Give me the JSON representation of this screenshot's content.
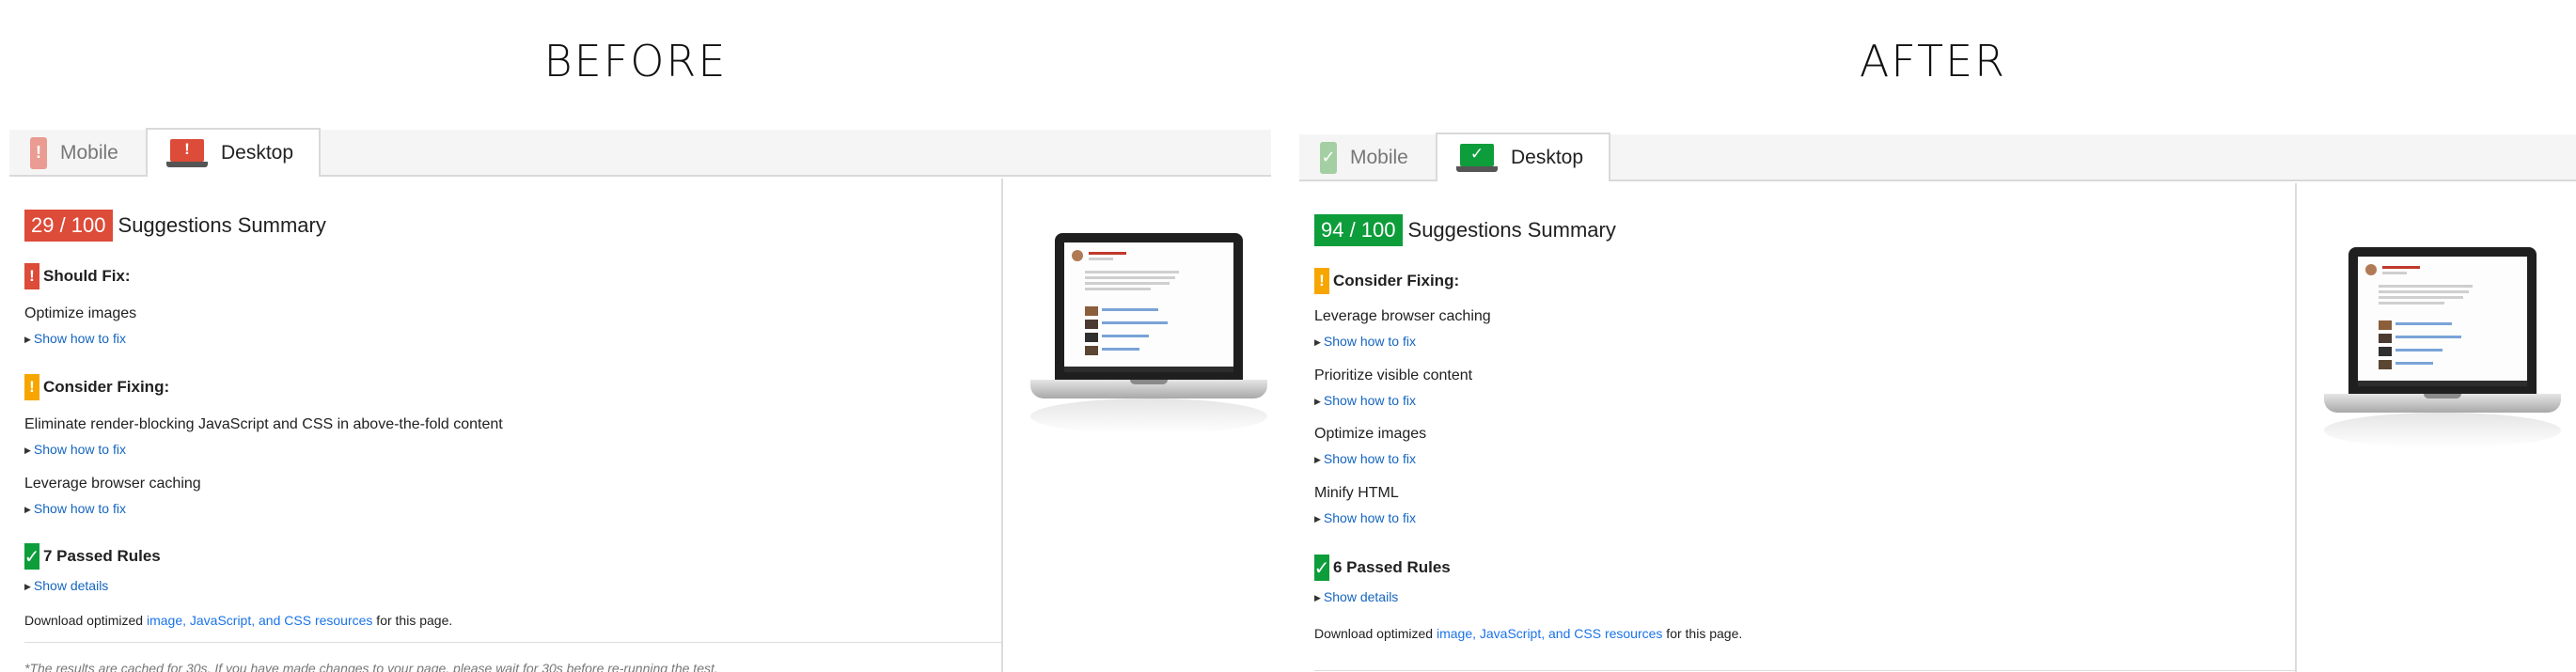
{
  "before": {
    "heading": "BEFORE",
    "tabs": [
      {
        "label": "Mobile",
        "icon": "phone-warning-icon"
      },
      {
        "label": "Desktop",
        "icon": "laptop-warning-icon"
      }
    ],
    "score": "29 / 100",
    "summary_title": "Suggestions Summary",
    "should_fix": {
      "title": "Should Fix:",
      "icon": "exclamation-icon",
      "rules": [
        {
          "name": "Optimize images",
          "link": "Show how to fix"
        }
      ]
    },
    "consider_fixing": {
      "title": "Consider Fixing:",
      "icon": "exclamation-icon",
      "rules": [
        {
          "name": "Eliminate render-blocking JavaScript and CSS in above-the-fold content",
          "link": "Show how to fix"
        },
        {
          "name": "Leverage browser caching",
          "link": "Show how to fix"
        }
      ]
    },
    "passed": {
      "title": "7 Passed Rules",
      "link": "Show details",
      "icon": "checkmark-icon"
    },
    "download": {
      "prefix": "Download optimized ",
      "link": "image, JavaScript, and CSS resources",
      "suffix": " for this page."
    },
    "note": "*The results are cached for 30s. If you have made changes to your page, please wait for 30s before re-running the test."
  },
  "after": {
    "heading": "AFTER",
    "tabs": [
      {
        "label": "Mobile",
        "icon": "phone-check-icon"
      },
      {
        "label": "Desktop",
        "icon": "laptop-check-icon"
      }
    ],
    "score": "94 / 100",
    "summary_title": "Suggestions Summary",
    "consider_fixing": {
      "title": "Consider Fixing:",
      "icon": "exclamation-icon",
      "rules": [
        {
          "name": "Leverage browser caching",
          "link": "Show how to fix"
        },
        {
          "name": "Prioritize visible content",
          "link": "Show how to fix"
        },
        {
          "name": "Optimize images",
          "link": "Show how to fix"
        },
        {
          "name": "Minify HTML",
          "link": "Show how to fix"
        }
      ]
    },
    "passed": {
      "title": "6 Passed Rules",
      "link": "Show details",
      "icon": "checkmark-icon"
    },
    "download": {
      "prefix": "Download optimized ",
      "link": "image, JavaScript, and CSS resources",
      "suffix": " for this page."
    }
  },
  "colors": {
    "score_bad": "#dd4b39",
    "score_good": "#0d9d3a",
    "warning": "#f7a600",
    "link": "#1565c0"
  }
}
